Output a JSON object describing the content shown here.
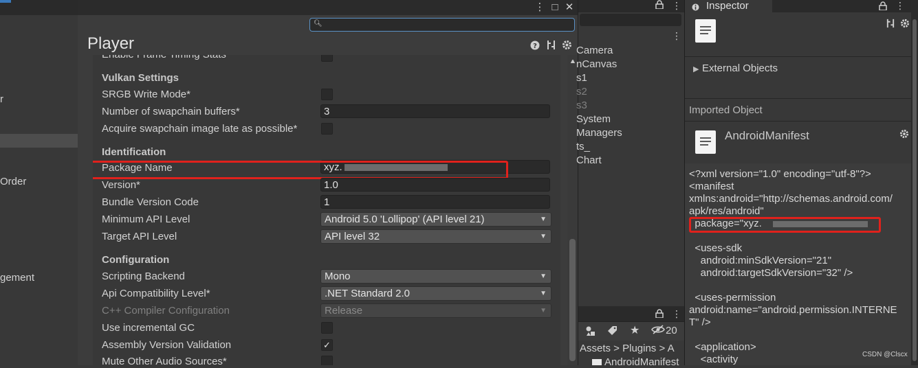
{
  "left_panel": {
    "items": [
      "r",
      "Order",
      "gement"
    ]
  },
  "settings_window": {
    "title_buttons": {
      "more": "⋮",
      "maximize": "□",
      "close": "✕"
    },
    "search": {
      "placeholder": ""
    },
    "player_title": "Player",
    "header_icons": [
      "help-icon",
      "preset-icon",
      "gear-icon"
    ],
    "rows": {
      "frame_timing": "Enable Frame Timing Stats",
      "vulkan_header": "Vulkan Settings",
      "srgb": "SRGB Write Mode*",
      "swapchain_buffers": "Number of swapchain buffers*",
      "swapchain_buffers_value": "3",
      "acquire_late": "Acquire swapchain image late as possible*",
      "identification_header": "Identification",
      "package_name": "Package Name",
      "package_name_value": "xyz.",
      "version": "Version*",
      "version_value": "1.0",
      "bundle_version_code": "Bundle Version Code",
      "bundle_version_code_value": "1",
      "min_api": "Minimum API Level",
      "min_api_value": "Android 5.0 'Lollipop' (API level 21)",
      "target_api": "Target API Level",
      "target_api_value": "API level 32",
      "configuration_header": "Configuration",
      "scripting_backend": "Scripting Backend",
      "scripting_backend_value": "Mono",
      "api_compat": "Api Compatibility Level*",
      "api_compat_value": ".NET Standard 2.0",
      "cpp_config": "C++ Compiler Configuration",
      "cpp_config_value": "Release",
      "incremental_gc": "Use incremental GC",
      "assembly_validation": "Assembly Version Validation",
      "mute_audio": "Mute Other Audio Sources*"
    },
    "checkbox_states": {
      "assembly_validation": "✓"
    }
  },
  "hierarchy": {
    "items": [
      {
        "label": "Camera",
        "dim": false
      },
      {
        "label": "nCanvas",
        "dim": false
      },
      {
        "label": "s1",
        "dim": false
      },
      {
        "label": "s2",
        "dim": true
      },
      {
        "label": "s3",
        "dim": true
      },
      {
        "label": "System",
        "dim": false
      },
      {
        "label": "Managers",
        "dim": false
      },
      {
        "label": "ts_",
        "dim": false
      },
      {
        "label": "Chart",
        "dim": false
      }
    ],
    "project_counter": "20",
    "breadcrumb": "Assets > Plugins > A",
    "file_row": "AndroidManifest"
  },
  "inspector": {
    "tab_title": "Inspector",
    "external_objects": "External Objects",
    "imported_object": "Imported Object",
    "asset_name": "AndroidManifest",
    "code_lines": [
      "<?xml version=\"1.0\" encoding=\"utf-8\"?>",
      "<manifest",
      "xmlns:android=\"http://schemas.android.com/",
      "apk/res/android\"",
      "  package=\"xyz.",
      "",
      "  <uses-sdk",
      "    android:minSdkVersion=\"21\"",
      "    android:targetSdkVersion=\"32\" />",
      "",
      "  <uses-permission",
      "android:name=\"android.permission.INTERNE",
      "T\" />",
      "",
      "  <application>",
      "    <activity"
    ]
  },
  "watermark": "CSDN @Clscx",
  "colors": {
    "highlight_box": "#e0211c",
    "search_focus": "#5b92c6"
  }
}
